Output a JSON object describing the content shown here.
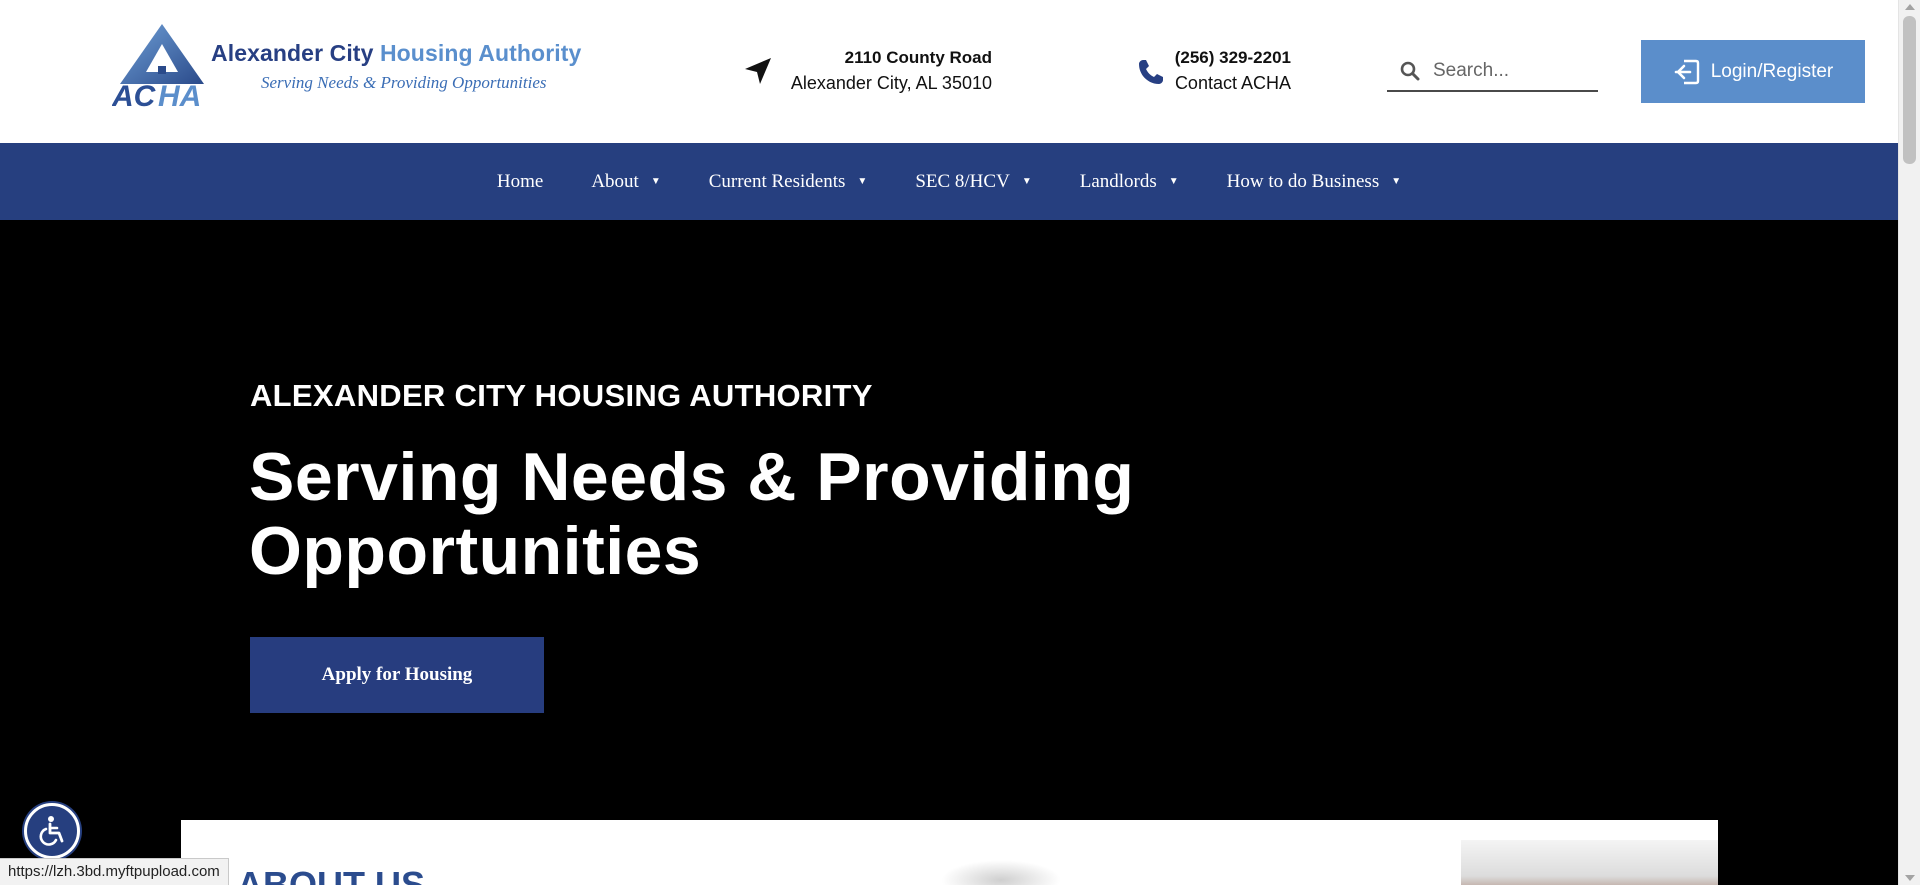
{
  "header": {
    "logo": {
      "title_main": "Alexander City ",
      "title_highlight": "Housing Authority",
      "tagline": "Serving Needs & Providing Opportunities",
      "mark_text": "ACHA"
    },
    "address": {
      "line1": "2110 County Road",
      "line2": "Alexander City, AL 35010",
      "icon": "location-arrow-icon"
    },
    "phone": {
      "line1": "(256) 329-2201",
      "line2": "Contact ACHA",
      "icon": "phone-icon"
    },
    "search": {
      "placeholder": "Search...",
      "value": ""
    },
    "login_label": "Login/Register"
  },
  "nav": {
    "items": [
      {
        "label": "Home",
        "dropdown": false
      },
      {
        "label": "About",
        "dropdown": true
      },
      {
        "label": "Current Residents",
        "dropdown": true
      },
      {
        "label": "SEC 8/HCV",
        "dropdown": true
      },
      {
        "label": "Landlords",
        "dropdown": true
      },
      {
        "label": "How to do Business",
        "dropdown": true
      }
    ],
    "caret": "▼"
  },
  "hero": {
    "kicker": "ALEXANDER CITY HOUSING AUTHORITY",
    "title": "Serving Needs & Providing Opportunities",
    "cta_label": "Apply for Housing"
  },
  "about": {
    "heading": "ABOUT US"
  },
  "status_bar": {
    "url": "https://lzh.3bd.myftpupload.com"
  },
  "colors": {
    "brand_navy": "#263f7f",
    "brand_light_blue": "#5b8ecb",
    "hero_background": "#000000"
  }
}
